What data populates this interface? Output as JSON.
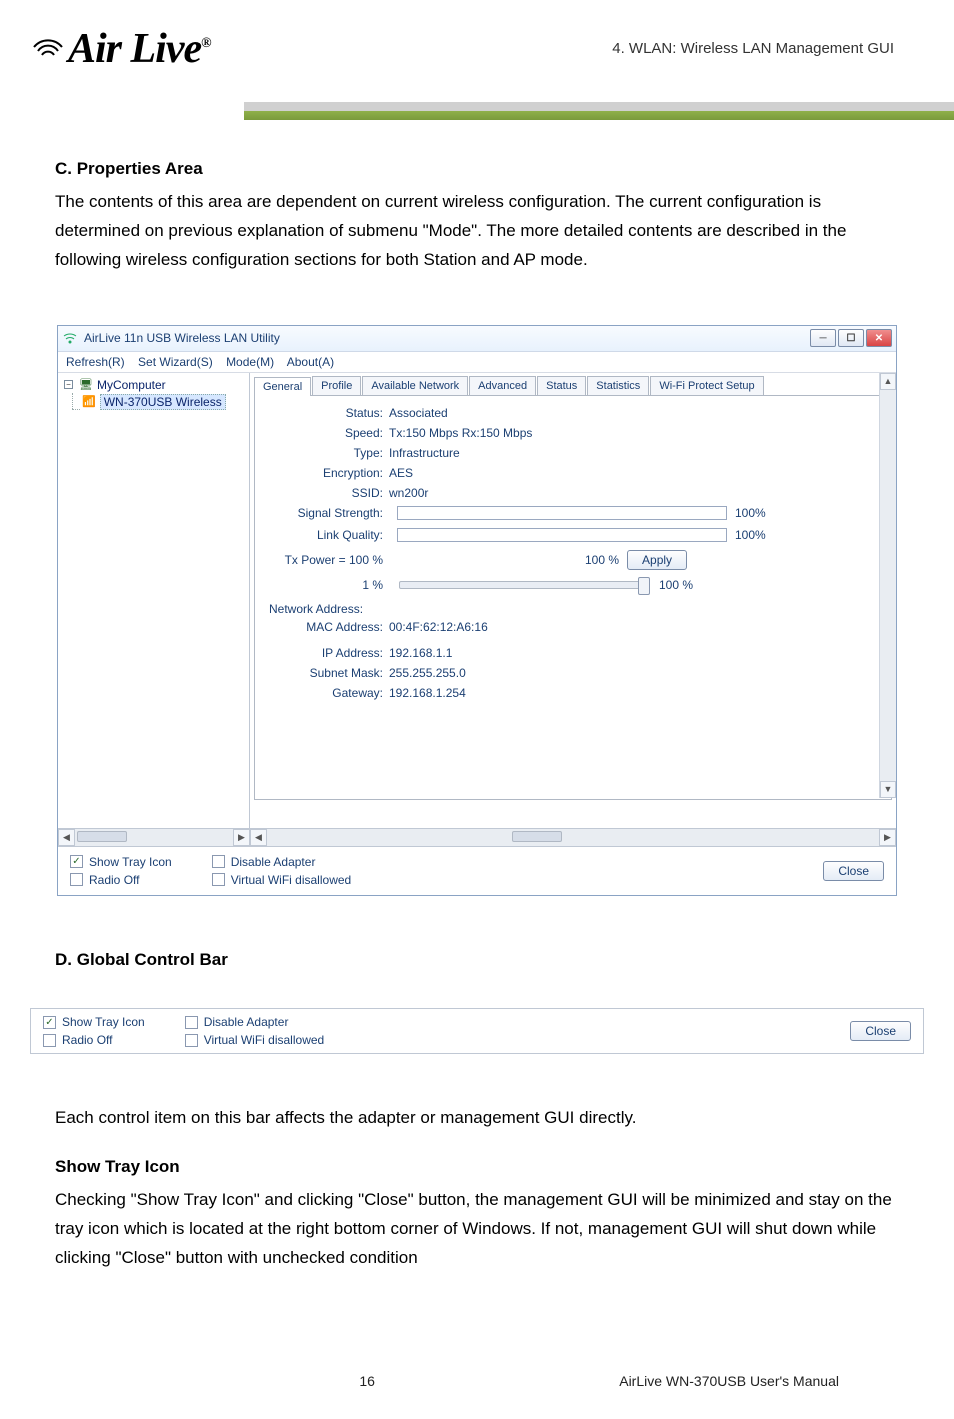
{
  "breadcrumb": "4.  WLAN:  Wireless  LAN  Management  GUI",
  "logo": {
    "brand_a": "A",
    "brand_rest": "ir Live",
    "reg": "®"
  },
  "section_c": {
    "title": "C. Properties Area",
    "text": "The contents of this area are dependent on current wireless configuration. The current configuration is determined on previous explanation of submenu \"Mode\". The more detailed contents are described in the following wireless configuration sections for both Station and AP mode."
  },
  "window": {
    "title": "AirLive 11n USB Wireless LAN Utility",
    "menu": [
      "Refresh(R)",
      "Set Wizard(S)",
      "Mode(M)",
      "About(A)"
    ],
    "tree": {
      "root": "MyComputer",
      "child": "WN-370USB Wireless"
    },
    "tabs": [
      "General",
      "Profile",
      "Available Network",
      "Advanced",
      "Status",
      "Statistics",
      "Wi-Fi Protect Setup"
    ],
    "general": {
      "status_lbl": "Status:",
      "status_val": "Associated",
      "speed_lbl": "Speed:",
      "speed_val": "Tx:150 Mbps Rx:150 Mbps",
      "type_lbl": "Type:",
      "type_val": "Infrastructure",
      "enc_lbl": "Encryption:",
      "enc_val": "AES",
      "ssid_lbl": "SSID:",
      "ssid_val": "wn200r",
      "sigstr_lbl": "Signal Strength:",
      "sigstr_pct": "100%",
      "linkq_lbl": "Link Quality:",
      "linkq_pct": "100%",
      "txpower_lbl": "Tx Power =",
      "txpower_val": "100 %",
      "txpower_bar": "100 %",
      "apply": "Apply",
      "slidermin": "1 %",
      "slidermax": "100 %",
      "netaddr": "Network Address:",
      "mac_lbl": "MAC Address:",
      "mac_val": "00:4F:62:12:A6:16",
      "ip_lbl": "IP Address:",
      "ip_val": "192.168.1.1",
      "subnet_lbl": "Subnet Mask:",
      "subnet_val": "255.255.255.0",
      "gw_lbl": "Gateway:",
      "gw_val": "192.168.1.254"
    },
    "bottom": {
      "show_tray": "Show Tray Icon",
      "radio_off": "Radio Off",
      "disable": "Disable Adapter",
      "virtual": "Virtual WiFi disallowed",
      "close": "Close"
    }
  },
  "section_d": {
    "title": "D. Global Control Bar",
    "text": "Each control item on this bar affects the adapter or management GUI directly."
  },
  "section_tray": {
    "title": "Show Tray Icon",
    "text": "Checking \"Show Tray Icon\" and clicking \"Close\" button, the management GUI will be minimized and stay on the tray icon which is located at the right bottom corner of Windows. If not, management GUI will shut down while clicking \"Close\" button with unchecked condition"
  },
  "footer": {
    "page": "16",
    "doc": "AirLive WN-370USB User's Manual"
  },
  "chart_data": {
    "type": "bar",
    "title": "Signal / Link bars shown in utility",
    "series": [
      {
        "name": "Signal Strength",
        "values": [
          100
        ]
      },
      {
        "name": "Link Quality",
        "values": [
          100
        ]
      }
    ],
    "ylim": [
      0,
      100
    ]
  }
}
